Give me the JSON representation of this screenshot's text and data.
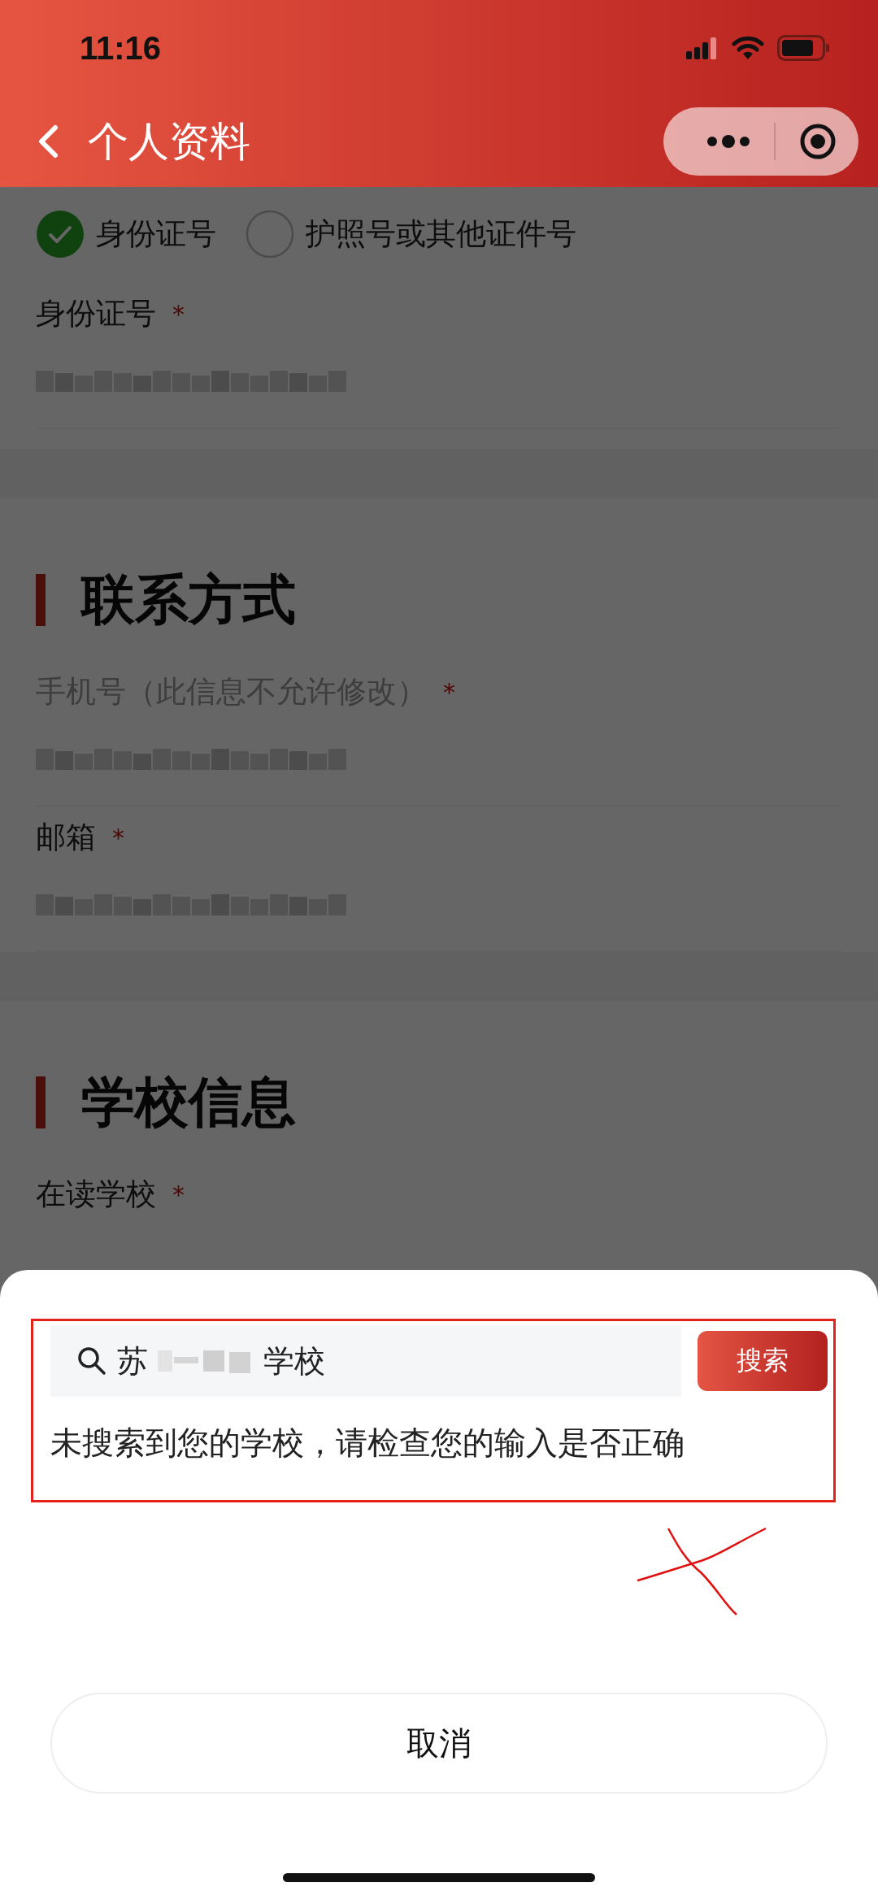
{
  "status_bar": {
    "time": "11:16"
  },
  "nav_bar": {
    "title": "个人资料"
  },
  "id_options": [
    {
      "label": "身份证号",
      "selected": true
    },
    {
      "label": "护照号或其他证件号",
      "selected": false
    }
  ],
  "id_fields": [
    {
      "label": "身份证号",
      "required_mark": "*",
      "disabled": false,
      "kind": "blurred"
    }
  ],
  "sections": [
    {
      "title": "联系方式",
      "fields": [
        {
          "label": "手机号（此信息不允许修改）",
          "required_mark": "*",
          "disabled": true,
          "kind": "blurred"
        },
        {
          "label": "邮箱",
          "required_mark": "*",
          "disabled": false,
          "kind": "blurred"
        }
      ]
    },
    {
      "title": "学校信息",
      "fields": [
        {
          "label": "在读学校",
          "required_mark": "*",
          "disabled": false,
          "kind": "select"
        }
      ]
    }
  ],
  "search_sheet": {
    "query_start": "苏",
    "query_end": "学校",
    "button": "搜索",
    "message": "未搜索到您的学校，请检查您的输入是否正确",
    "cancel": "取消"
  },
  "annotations": {
    "highlight_frame": true,
    "cross_mark": true
  }
}
